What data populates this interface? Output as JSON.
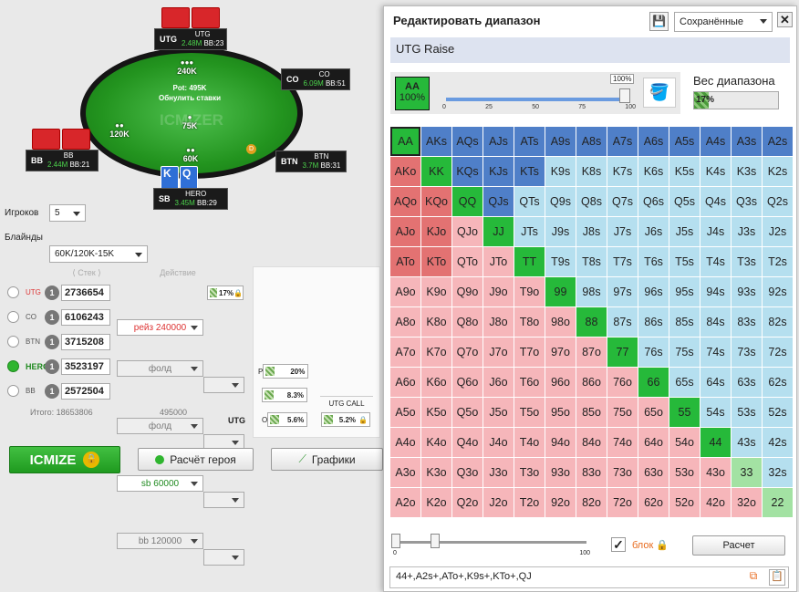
{
  "table": {
    "utg": {
      "pos": "UTG",
      "stack": "2.48M",
      "bb": "BB:23"
    },
    "co": {
      "pos": "CO",
      "stack": "6.09M",
      "bb": "BB:51"
    },
    "btn": {
      "pos": "BTN",
      "stack": "3.7M",
      "bb": "BB:31"
    },
    "bb": {
      "pos": "BB",
      "stack": "2.44M",
      "bb": "BB:21"
    },
    "hero": {
      "pos": "SB",
      "name": "HERO",
      "stack": "3.45M",
      "bb": "BB:29"
    },
    "seat_utg": "UTG",
    "seat_co": "CO",
    "seat_btn": "BTN",
    "seat_bb": "BB",
    "seat_sb": "SB",
    "pot": "Pot: 495K",
    "reset": "Обнулить ставки",
    "bet_utg": "240K",
    "bet_bb": "120K",
    "bet_sb": "60K",
    "bet_mid": "75K",
    "watermark": "ICMIZER",
    "hero_cards": [
      "K",
      "Q"
    ]
  },
  "controls": {
    "players_label": "Игроков",
    "players_value": "5",
    "blinds_label": "Блайнды",
    "blinds_value": "60K/120K-15K",
    "stack_header": "Стек",
    "action_header": "Действие",
    "rows": [
      {
        "pos": "UTG",
        "n": "1",
        "stack": "2736654",
        "action": "рейз 240000",
        "pct": "17%"
      },
      {
        "pos": "CO",
        "n": "1",
        "stack": "6106243",
        "action": "фолд"
      },
      {
        "pos": "BTN",
        "n": "1",
        "stack": "3715208",
        "action": "фолд"
      },
      {
        "pos": "HERO",
        "n": "1",
        "stack": "3523197",
        "action": "sb 60000"
      },
      {
        "pos": "BB",
        "n": "1",
        "stack": "2572504",
        "action": "bb 120000"
      }
    ],
    "total_label": "Итого: 18653806",
    "total_action": "495000",
    "p_label": "P",
    "p_pct": "20%",
    "pct2": "8.3%",
    "o_label": "O",
    "o_pct": "5.6%",
    "utg_call": "UTG CALL",
    "utg_call_pct": "5.2%",
    "utg_label": "UTG"
  },
  "buttons": {
    "icmize": "ICMIZE",
    "hero_calc": "Расчёт героя",
    "charts": "Графики"
  },
  "dialog": {
    "title": "Редактировать диапазон",
    "saved": "Сохранённые",
    "range_name": "UTG Raise",
    "selected_hand": "AA",
    "selected_pct": "100%",
    "slider_pct": "100%",
    "ticks": [
      "0",
      "25",
      "50",
      "75",
      "100"
    ],
    "weight_label": "Вес диапазона",
    "weight_value": "17%",
    "block_label": "блок",
    "calc_button": "Расчет",
    "bottom_ticks": [
      "0",
      "100"
    ],
    "range_text": "44+,A2s+,ATo+,K9s+,KTo+,QJ"
  },
  "matrix": [
    [
      "AA",
      "AKs",
      "AQs",
      "AJs",
      "ATs",
      "A9s",
      "A8s",
      "A7s",
      "A6s",
      "A5s",
      "A4s",
      "A3s",
      "A2s"
    ],
    [
      "AKo",
      "KK",
      "KQs",
      "KJs",
      "KTs",
      "K9s",
      "K8s",
      "K7s",
      "K6s",
      "K5s",
      "K4s",
      "K3s",
      "K2s"
    ],
    [
      "AQo",
      "KQo",
      "QQ",
      "QJs",
      "QTs",
      "Q9s",
      "Q8s",
      "Q7s",
      "Q6s",
      "Q5s",
      "Q4s",
      "Q3s",
      "Q2s"
    ],
    [
      "AJo",
      "KJo",
      "QJo",
      "JJ",
      "JTs",
      "J9s",
      "J8s",
      "J7s",
      "J6s",
      "J5s",
      "J4s",
      "J3s",
      "J2s"
    ],
    [
      "ATo",
      "KTo",
      "QTo",
      "JTo",
      "TT",
      "T9s",
      "T8s",
      "T7s",
      "T6s",
      "T5s",
      "T4s",
      "T3s",
      "T2s"
    ],
    [
      "A9o",
      "K9o",
      "Q9o",
      "J9o",
      "T9o",
      "99",
      "98s",
      "97s",
      "96s",
      "95s",
      "94s",
      "93s",
      "92s"
    ],
    [
      "A8o",
      "K8o",
      "Q8o",
      "J8o",
      "T8o",
      "98o",
      "88",
      "87s",
      "86s",
      "85s",
      "84s",
      "83s",
      "82s"
    ],
    [
      "A7o",
      "K7o",
      "Q7o",
      "J7o",
      "T7o",
      "97o",
      "87o",
      "77",
      "76s",
      "75s",
      "74s",
      "73s",
      "72s"
    ],
    [
      "A6o",
      "K6o",
      "Q6o",
      "J6o",
      "T6o",
      "96o",
      "86o",
      "76o",
      "66",
      "65s",
      "64s",
      "63s",
      "62s"
    ],
    [
      "A5o",
      "K5o",
      "Q5o",
      "J5o",
      "T5o",
      "95o",
      "85o",
      "75o",
      "65o",
      "55",
      "54s",
      "53s",
      "52s"
    ],
    [
      "A4o",
      "K4o",
      "Q4o",
      "J4o",
      "T4o",
      "94o",
      "84o",
      "74o",
      "64o",
      "54o",
      "44",
      "43s",
      "42s"
    ],
    [
      "A3o",
      "K3o",
      "Q3o",
      "J3o",
      "T3o",
      "93o",
      "83o",
      "73o",
      "63o",
      "53o",
      "43o",
      "33",
      "32s"
    ],
    [
      "A2o",
      "K2o",
      "Q2o",
      "J2o",
      "T2o",
      "92o",
      "82o",
      "72o",
      "62o",
      "52o",
      "42o",
      "32o",
      "22"
    ]
  ],
  "matrix_colors": [
    "gpppppppppppp",
    "rgpppssssssss",
    "rrgpsssssssss",
    "rrogsssssssss",
    "rroogssssssss",
    "ooooogsssssss",
    "oooooogssssss",
    "ooooooogsssss",
    "oooooooogssss",
    "ooooooooogsss",
    "oooooooooogss",
    "oooooooooooLs",
    "ooooooooooooL"
  ],
  "colors": {
    "raise": "#4f7fc8",
    "pair": "#26b93a",
    "red": "#e37272",
    "icmize": "#2fa833"
  }
}
